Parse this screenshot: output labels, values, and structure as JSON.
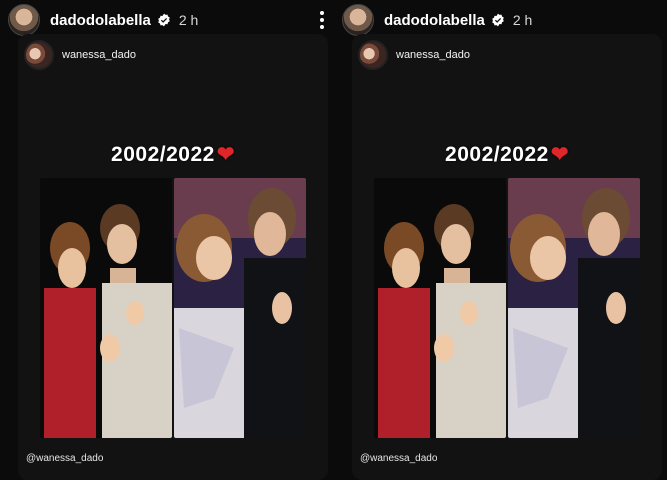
{
  "story": {
    "username": "dadodolabella",
    "time": "2 h",
    "shared_from": "wanessa_dado",
    "headline": "2002/2022",
    "heart": "❤",
    "mention": "@wanessa_dado"
  },
  "colors": {
    "heart": "#e0252b",
    "background": "#0b0b0c",
    "card": "#121212"
  },
  "icons": [
    "verified-badge-icon",
    "more-options-icon"
  ]
}
